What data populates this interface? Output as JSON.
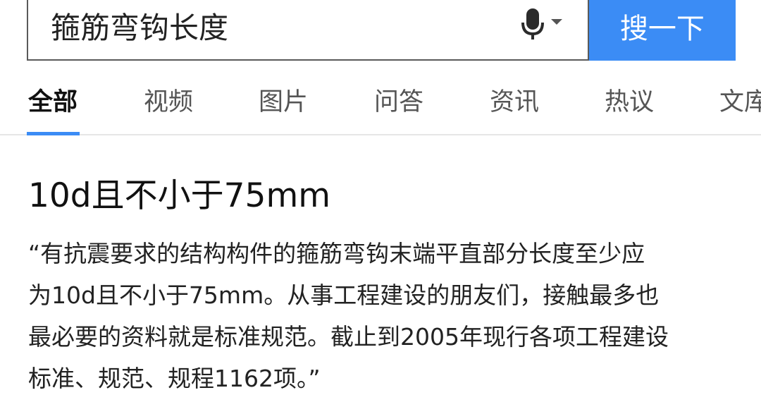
{
  "search": {
    "query": "箍筋弯钩长度",
    "button_label": "搜一下"
  },
  "tabs": [
    {
      "label": "全部",
      "active": true
    },
    {
      "label": "视频",
      "active": false
    },
    {
      "label": "图片",
      "active": false
    },
    {
      "label": "问答",
      "active": false
    },
    {
      "label": "资讯",
      "active": false
    },
    {
      "label": "热议",
      "active": false
    },
    {
      "label": "文库",
      "active": false
    }
  ],
  "result": {
    "title": "10d且不小于75mm",
    "snippet_lines": [
      "“有抗震要求的结构构件的箍筋弯钩末端平直部分长度至少应",
      "为10d且不小于75mm。从事工程建设的朋友们，接触最多也",
      "最必要的资料就是标准规范。截止到2005年现行各项工程建设",
      "标准、规范、规程1162项。”"
    ]
  },
  "colors": {
    "accent": "#3b8cf5",
    "text": "#222222",
    "tab_inactive": "#555555"
  },
  "icons": {
    "voice": "microphone-icon",
    "dropdown": "caret-down-icon"
  }
}
